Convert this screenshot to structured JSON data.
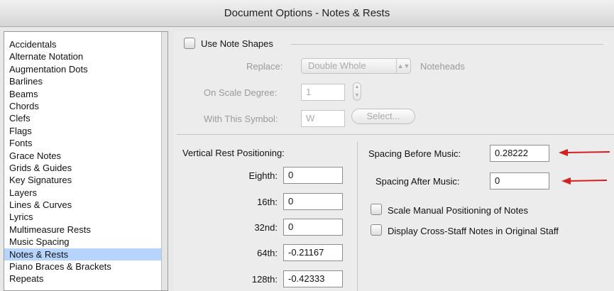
{
  "window": {
    "title": "Document Options - Notes & Rests"
  },
  "sidebar": {
    "selected": "Notes & Rests",
    "items": [
      "Accidentals",
      "Alternate Notation",
      "Augmentation Dots",
      "Barlines",
      "Beams",
      "Chords",
      "Clefs",
      "Flags",
      "Fonts",
      "Grace Notes",
      "Grids & Guides",
      "Key Signatures",
      "Layers",
      "Lines & Curves",
      "Lyrics",
      "Multimeasure Rests",
      "Music Spacing",
      "Notes & Rests",
      "Piano Braces & Brackets",
      "Repeats"
    ]
  },
  "note_shapes": {
    "checkbox_label": "Use Note Shapes",
    "replace_label": "Replace:",
    "replace_value": "Double Whole",
    "replace_suffix": "Noteheads",
    "scale_degree_label": "On Scale Degree:",
    "scale_degree_value": "1",
    "symbol_label": "With This Symbol:",
    "symbol_value": "W",
    "select_button": "Select..."
  },
  "rest_positioning": {
    "heading": "Vertical Rest Positioning:",
    "rows": [
      {
        "label": "Eighth:",
        "value": "0"
      },
      {
        "label": "16th:",
        "value": "0"
      },
      {
        "label": "32nd:",
        "value": "0"
      },
      {
        "label": "64th:",
        "value": "-0.21167"
      },
      {
        "label": "128th:",
        "value": "-0.42333"
      }
    ]
  },
  "spacing": {
    "before_label": "Spacing Before Music:",
    "before_value": "0.28222",
    "after_label": "Spacing After Music:",
    "after_value": "0"
  },
  "options": {
    "scale_manual_label": "Scale Manual Positioning of Notes",
    "cross_staff_label": "Display Cross-Staff Notes in Original Staff"
  },
  "annotation": {
    "arrow_color": "#d42020"
  }
}
